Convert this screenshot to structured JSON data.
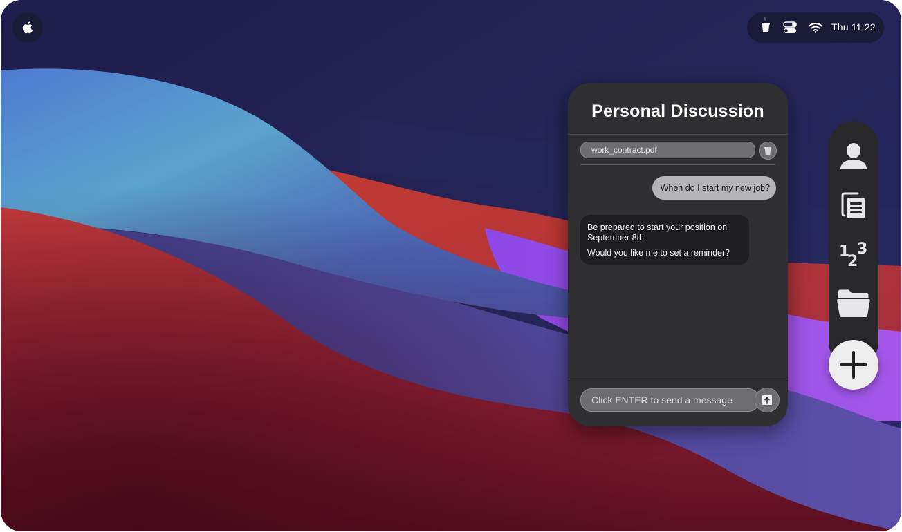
{
  "menubar": {
    "apple_icon": "apple-logo-icon",
    "status_icons": [
      "coffee-cup-icon",
      "control-center-toggles-icon",
      "wifi-icon"
    ],
    "clock": "Thu 11:22"
  },
  "chat": {
    "title": "Personal Discussion",
    "attachment": {
      "filename": "work_contract.pdf",
      "remove_icon": "trash-icon"
    },
    "messages": [
      {
        "from": "user",
        "lines": [
          "When do I start my new job?"
        ]
      },
      {
        "from": "assistant",
        "lines": [
          "Be prepared to start your position on September 8th.",
          "Would you like me to set a reminder?"
        ]
      }
    ],
    "input_placeholder": "Click ENTER to send a message",
    "send_icon": "upload-arrow-icon"
  },
  "dock": {
    "items": [
      "person-icon",
      "documents-icon",
      "numbers-icon",
      "folder-icon"
    ],
    "add_icon": "plus-icon"
  },
  "colors": {
    "panel": "#2f2f31",
    "dock": "#29292b",
    "user_bubble": "#b5b5b8",
    "bot_bubble": "#1f1f21",
    "pill": "#6e6e71"
  }
}
